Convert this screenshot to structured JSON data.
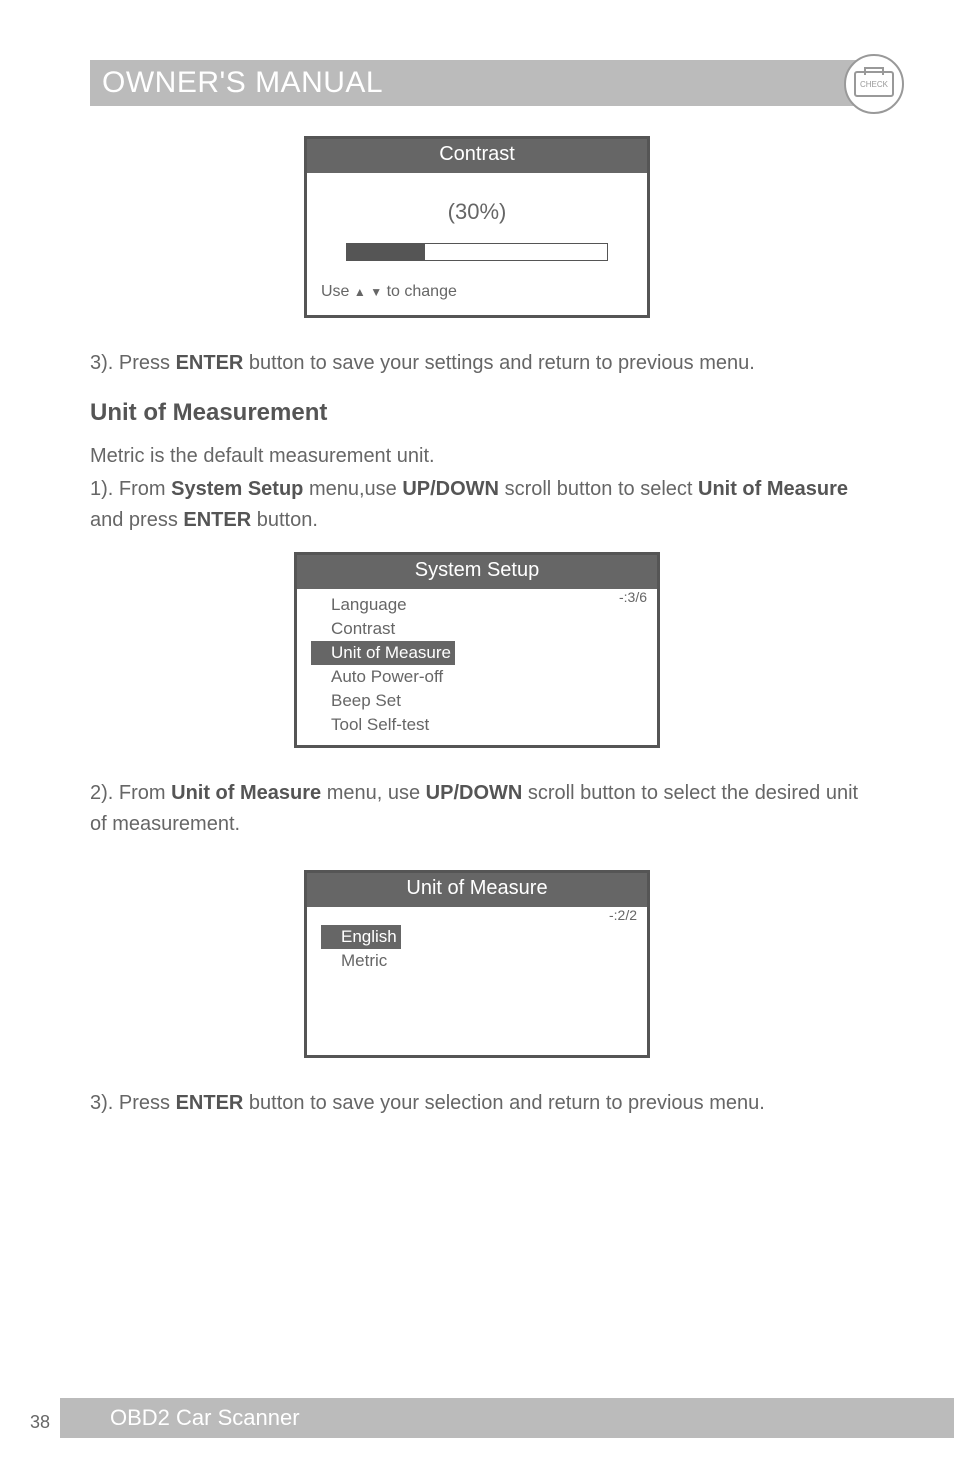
{
  "header": {
    "title": "OWNER'S MANUAL",
    "badge": "CHECK"
  },
  "screen1": {
    "title": "Contrast",
    "value": "(30%)",
    "hint_prefix": "Use",
    "hint_suffix": "to change"
  },
  "para1_a": "3). Press ",
  "para1_b": "ENTER",
  "para1_c": " button to save your settings and return to previous menu.",
  "section": "Unit of Measurement",
  "para2": "Metric is the default measurement unit.",
  "para3_a": "1). From ",
  "para3_b": "System Setup",
  "para3_c": " menu,use ",
  "para3_d": "UP/DOWN",
  "para3_e": " scroll button to select ",
  "para3_f": "Unit of Measure",
  "para3_g": " and press ",
  "para3_h": "ENTER",
  "para3_i": " button.",
  "screen2": {
    "title": "System Setup",
    "count": "-:3/6",
    "items": {
      "0": "Language",
      "1": "Contrast",
      "2": "Unit of Measure",
      "3": "Auto Power-off",
      "4": "Beep Set",
      "5": "Tool Self-test"
    }
  },
  "para4_a": "2). From ",
  "para4_b": "Unit of Measure",
  "para4_c": " menu, use ",
  "para4_d": "UP/DOWN",
  "para4_e": " scroll button to select the desired unit of measurement.",
  "screen3": {
    "title": "Unit of Measure",
    "count": "-:2/2",
    "items": {
      "0": "English",
      "1": "Metric"
    }
  },
  "para5_a": "3). Press ",
  "para5_b": "ENTER",
  "para5_c": " button to save your selection and return to previous menu.",
  "footer": {
    "title": "OBD2 Car Scanner",
    "page": "38"
  }
}
